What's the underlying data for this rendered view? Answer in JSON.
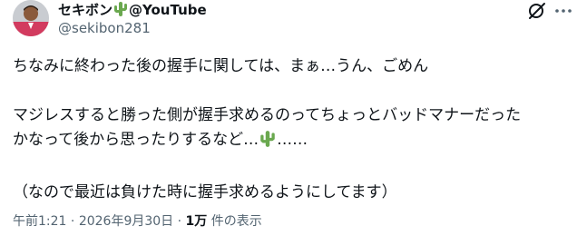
{
  "post": {
    "author": {
      "name_prefix": "セキボン",
      "name_emoji": "cactus-emoji",
      "name_suffix": "@YouTube",
      "handle": "@sekibon281",
      "avatar_icon": "avatar-photo"
    },
    "header_actions": {
      "grok_icon": "grok-icon",
      "more_icon": "more-options-icon"
    },
    "text": {
      "line1": "ちなみに終わった後の握手に関しては、まぁ…うん、ごめん",
      "line2": "マジレスすると勝った側が握手求めるのってちょっとバッドマナーだった",
      "line3_before_emoji": "かなって後から思ったりするなど…",
      "line3_emoji": "cactus-emoji",
      "line3_after_emoji": "……",
      "line4": "（なので最近は負けた時に握手求めるようにしてます）"
    },
    "meta": {
      "time": "午前1:21",
      "separator1": " · ",
      "date": "2026年9月30日",
      "separator2": " · ",
      "views_count": "1万",
      "views_label": " 件の表示"
    }
  },
  "colors": {
    "text_primary": "#0f1419",
    "text_secondary": "#536471",
    "cactus_green": "#6aa84f",
    "background": "#ffffff"
  }
}
